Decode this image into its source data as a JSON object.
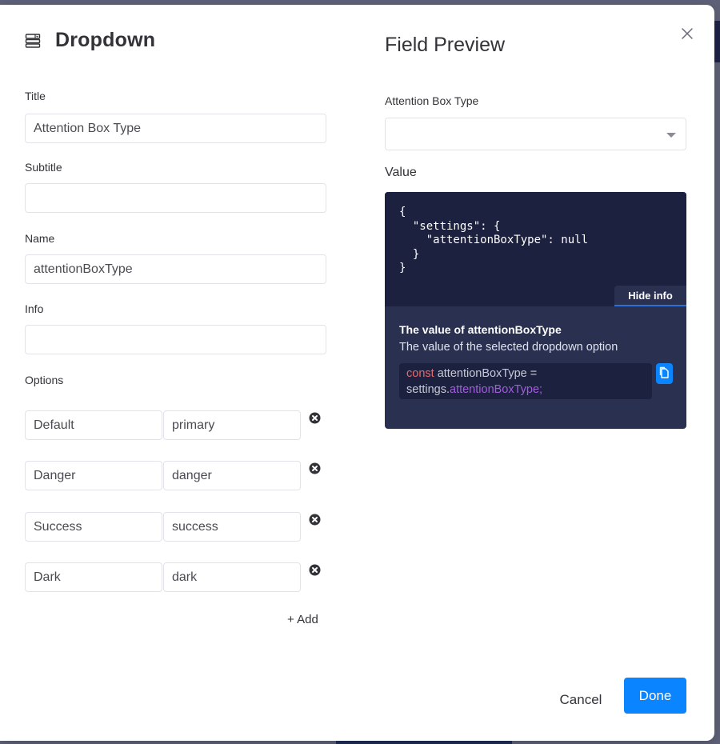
{
  "modal": {
    "title": "Dropdown",
    "title_icon": "dropdown-icon",
    "close_icon": "close-icon"
  },
  "form": {
    "title_label": "Title",
    "title_value": "Attention Box Type",
    "subtitle_label": "Subtitle",
    "subtitle_value": "",
    "name_label": "Name",
    "name_value": "attentionBoxType",
    "info_label": "Info",
    "info_value": "",
    "options_label": "Options",
    "options": [
      {
        "label": "Default",
        "value": "primary"
      },
      {
        "label": "Danger",
        "value": "danger"
      },
      {
        "label": "Success",
        "value": "success"
      },
      {
        "label": "Dark",
        "value": "dark"
      }
    ],
    "add_label": "+ Add",
    "remove_icon": "remove-circle-icon"
  },
  "preview": {
    "heading": "Field Preview",
    "field_label": "Attention Box Type",
    "field_selected": "",
    "value_label": "Value",
    "json_code": "{\n  \"settings\": {\n    \"attentionBoxType\": null\n  }\n}",
    "hide_info_label": "Hide info",
    "info_title": "The value of attentionBoxType",
    "info_description": "The value of the selected dropdown option",
    "snippet": {
      "keyword": "const",
      "line1_rest": " attentionBoxType =",
      "line2_prefix": "settings.",
      "line2_prop": "attentionBoxType;"
    },
    "copy_icon": "copy-icon"
  },
  "footer": {
    "cancel_label": "Cancel",
    "done_label": "Done"
  },
  "colors": {
    "primary": "#0b84ff",
    "code_bg": "#1d2140",
    "info_bg": "#293050",
    "keyword": "#e36a6a",
    "property": "#a25ddc"
  }
}
